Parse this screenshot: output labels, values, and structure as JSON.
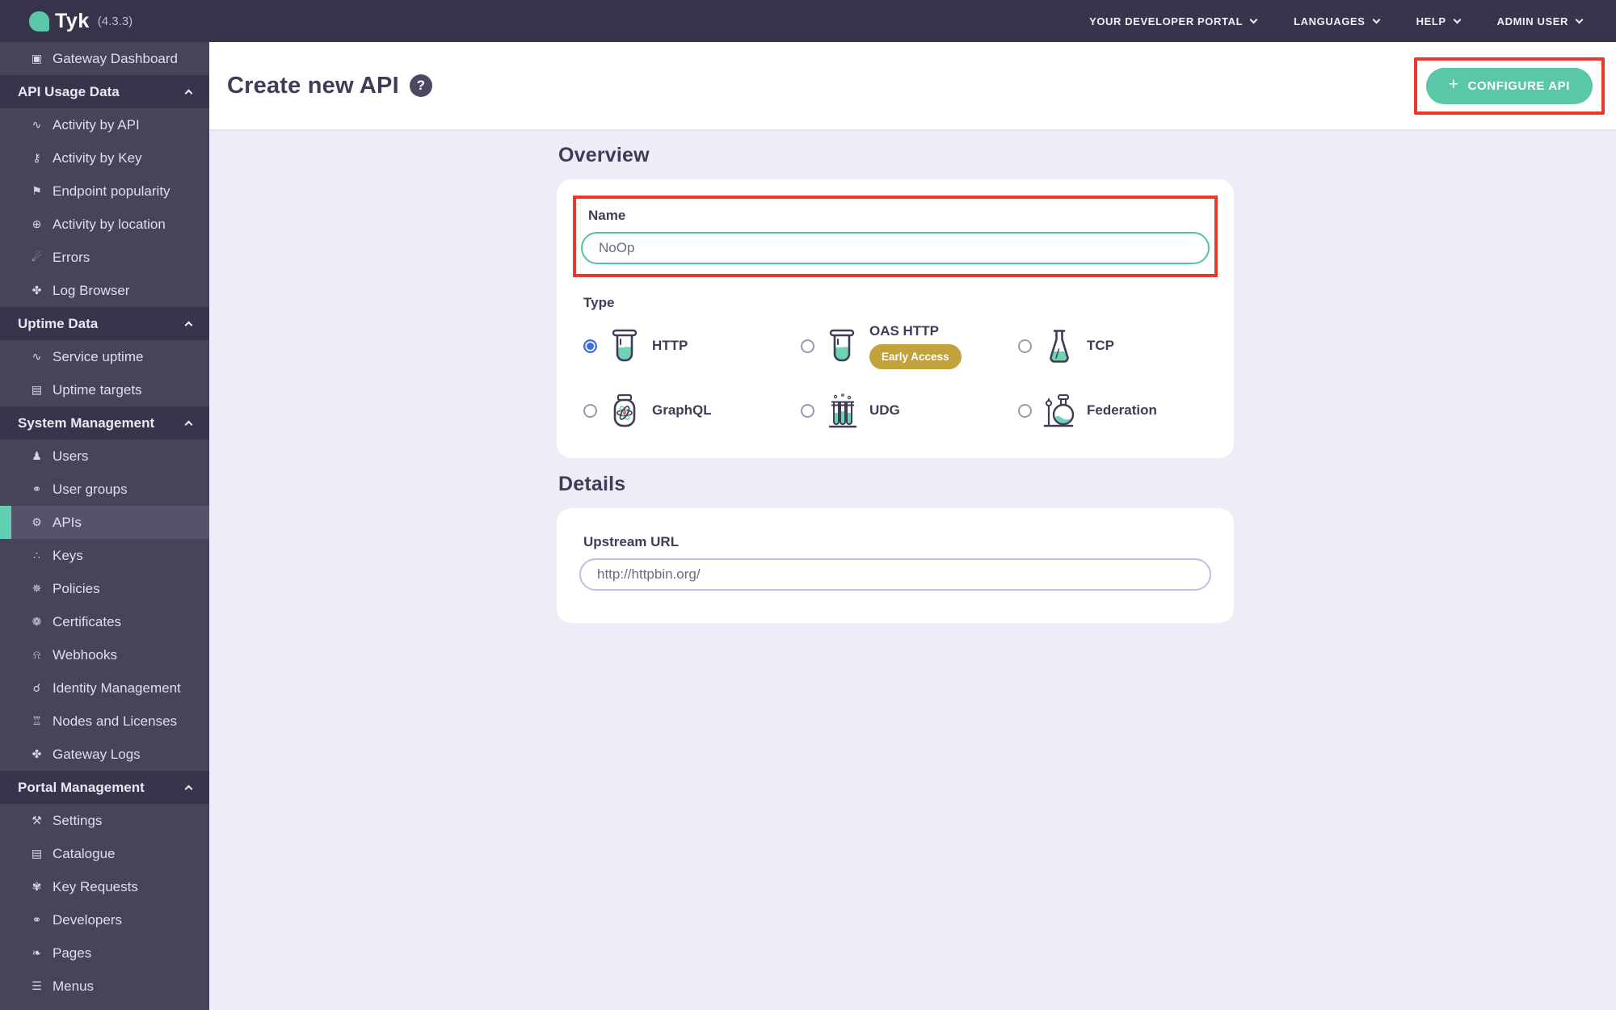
{
  "topbar": {
    "logo_text": "Tyk",
    "version": "(4.3.3)",
    "menus": [
      {
        "label": "YOUR DEVELOPER PORTAL"
      },
      {
        "label": "LANGUAGES"
      },
      {
        "label": "HELP"
      },
      {
        "label": "ADMIN USER"
      }
    ]
  },
  "sidebar": {
    "groups": [
      {
        "header": null,
        "items": [
          {
            "label": "Gateway Dashboard",
            "icon": "monitor-icon"
          }
        ]
      },
      {
        "header": "API Usage Data",
        "items": [
          {
            "label": "Activity by API",
            "icon": "chart-icon"
          },
          {
            "label": "Activity by Key",
            "icon": "key-icon"
          },
          {
            "label": "Endpoint popularity",
            "icon": "endpoint-icon"
          },
          {
            "label": "Activity by location",
            "icon": "globe-icon"
          },
          {
            "label": "Errors",
            "icon": "error-icon"
          },
          {
            "label": "Log Browser",
            "icon": "bug-icon"
          }
        ]
      },
      {
        "header": "Uptime Data",
        "items": [
          {
            "label": "Service uptime",
            "icon": "chart-icon"
          },
          {
            "label": "Uptime targets",
            "icon": "list-icon"
          }
        ]
      },
      {
        "header": "System Management",
        "items": [
          {
            "label": "Users",
            "icon": "user-icon"
          },
          {
            "label": "User groups",
            "icon": "users-icon"
          },
          {
            "label": "APIs",
            "icon": "gears-icon",
            "selected": true
          },
          {
            "label": "Keys",
            "icon": "sitemap-icon"
          },
          {
            "label": "Policies",
            "icon": "policy-icon"
          },
          {
            "label": "Certificates",
            "icon": "certificate-icon"
          },
          {
            "label": "Webhooks",
            "icon": "bell-icon"
          },
          {
            "label": "Identity Management",
            "icon": "identity-icon"
          },
          {
            "label": "Nodes and Licenses",
            "icon": "bank-icon"
          },
          {
            "label": "Gateway Logs",
            "icon": "bug-icon"
          }
        ]
      },
      {
        "header": "Portal Management",
        "items": [
          {
            "label": "Settings",
            "icon": "wrench-icon"
          },
          {
            "label": "Catalogue",
            "icon": "catalogue-icon"
          },
          {
            "label": "Key Requests",
            "icon": "paw-icon"
          },
          {
            "label": "Developers",
            "icon": "users-icon"
          },
          {
            "label": "Pages",
            "icon": "leaf-icon"
          },
          {
            "label": "Menus",
            "icon": "menu-icon"
          }
        ]
      }
    ]
  },
  "header": {
    "title": "Create new API",
    "help_glyph": "?",
    "configure_button": {
      "label": "CONFIGURE API",
      "plus": "+"
    }
  },
  "overview": {
    "heading": "Overview",
    "name_label": "Name",
    "name_value": "NoOp",
    "type_label": "Type",
    "types": [
      {
        "label": "HTTP",
        "icon": "beaker-icon",
        "selected": true
      },
      {
        "label": "OAS HTTP",
        "icon": "beaker-icon",
        "badge": "Early Access"
      },
      {
        "label": "TCP",
        "icon": "erlenmeyer-flask-icon"
      },
      {
        "label": "GraphQL",
        "icon": "atom-jar-icon"
      },
      {
        "label": "UDG",
        "icon": "test-tubes-icon"
      },
      {
        "label": "Federation",
        "icon": "round-flask-icon"
      }
    ]
  },
  "details": {
    "heading": "Details",
    "upstream_label": "Upstream URL",
    "upstream_placeholder": "http://httpbin.org/"
  },
  "colors": {
    "accent_teal": "#5BC7A9",
    "annotation_red": "#E8392C",
    "badge_gold": "#C2A23C",
    "radio_blue": "#3D6BE5",
    "topbar_bg": "#38344B",
    "sidebar_bg": "#47445A",
    "main_bg": "#EDEDF8"
  }
}
